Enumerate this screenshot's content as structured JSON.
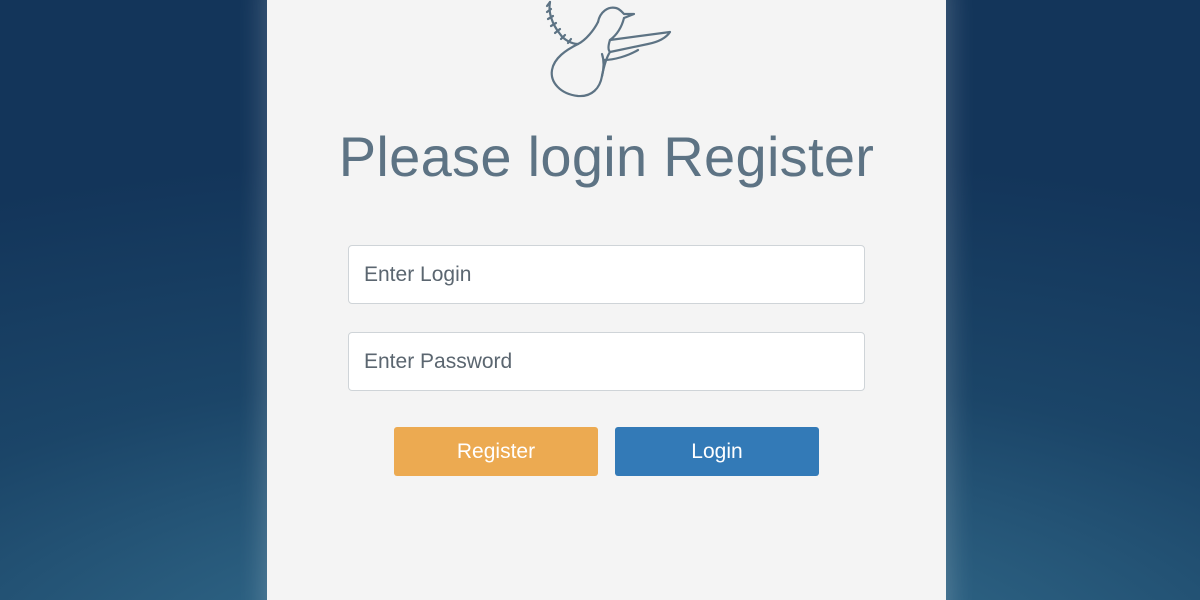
{
  "form": {
    "title": "Please login Register",
    "login_placeholder": "Enter Login",
    "password_placeholder": "Enter Password",
    "register_label": "Register",
    "login_label": "Login"
  },
  "logo": {
    "icon": "dove-icon",
    "stroke_color": "#5d7384"
  },
  "colors": {
    "register_button": "#ecaa51",
    "login_button": "#337ab7",
    "card_background": "#f4f4f4",
    "title_text": "#5d7384",
    "page_background": "#1b4568"
  }
}
